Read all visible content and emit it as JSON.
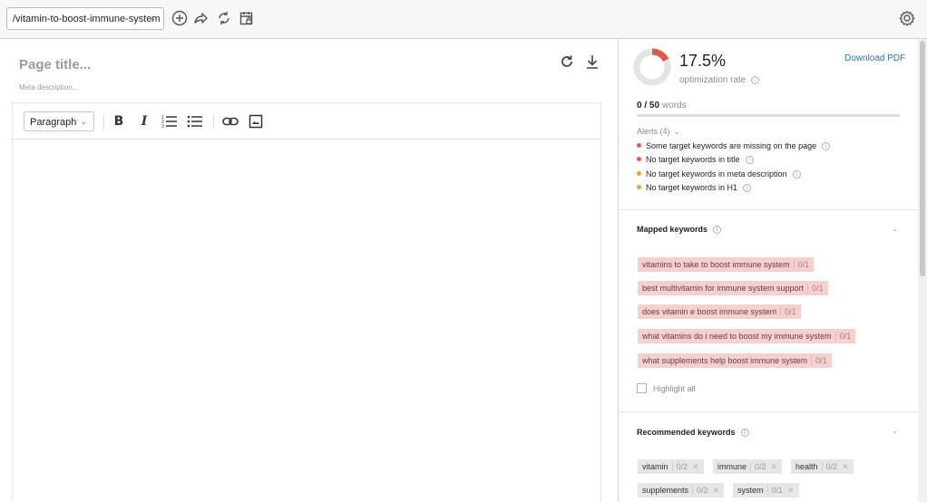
{
  "topbar": {
    "url_value": "/vitamin-to-boost-immune-system",
    "icons": [
      "add-circle-icon",
      "share-icon",
      "sync-icon",
      "calendar-lock-icon",
      "settings-gear-icon"
    ]
  },
  "editor": {
    "title_placeholder": "Page title...",
    "meta_placeholder": "Meta description...",
    "format_select": "Paragraph",
    "format_buttons": [
      "B",
      "I"
    ],
    "icons": [
      "refresh-icon",
      "download-icon",
      "ordered-list-icon",
      "bullet-list-icon",
      "link-icon",
      "image-icon"
    ]
  },
  "sidebar": {
    "optimization": {
      "rate": "17.5%",
      "rate_fraction": 0.175,
      "label": "optimization rate",
      "download_pdf": "Download PDF"
    },
    "words": {
      "count": "0 / 50",
      "unit": "words",
      "progress": 0
    },
    "alerts": {
      "header": "Alerts (4)",
      "items": [
        {
          "text": "Some target keywords are missing on the page",
          "color": "#e05a47"
        },
        {
          "text": "No target keywords in title",
          "color": "#e05a47"
        },
        {
          "text": "No target keywords in meta description",
          "color": "#f0a030"
        },
        {
          "text": "No target keywords in H1",
          "color": "#f0a030"
        }
      ]
    },
    "mapped": {
      "title": "Mapped keywords",
      "items": [
        {
          "kw": "vitamins to take to boost immune system",
          "count": "0/1"
        },
        {
          "kw": "best multivitamin for immune system support",
          "count": "0/1"
        },
        {
          "kw": "does vitamin e boost immune system",
          "count": "0/1"
        },
        {
          "kw": "what vitamins do i need to boost my immune system",
          "count": "0/1"
        },
        {
          "kw": "what supplements help boost immune system",
          "count": "0/1"
        }
      ],
      "highlight_all": "Highlight all"
    },
    "recommended": {
      "title": "Recommended keywords",
      "items": [
        {
          "kw": "vitamin",
          "count": "0/2"
        },
        {
          "kw": "immune",
          "count": "0/2"
        },
        {
          "kw": "health",
          "count": "0/2"
        },
        {
          "kw": "supplements",
          "count": "0/2"
        },
        {
          "kw": "system",
          "count": "0/1"
        }
      ]
    },
    "colors": {
      "accent_red": "#e05a47",
      "link_blue": "#2d6ec6",
      "mapped_tag_bg": "#f6cfcf",
      "recommended_tag_bg": "#e6e6e6"
    }
  }
}
